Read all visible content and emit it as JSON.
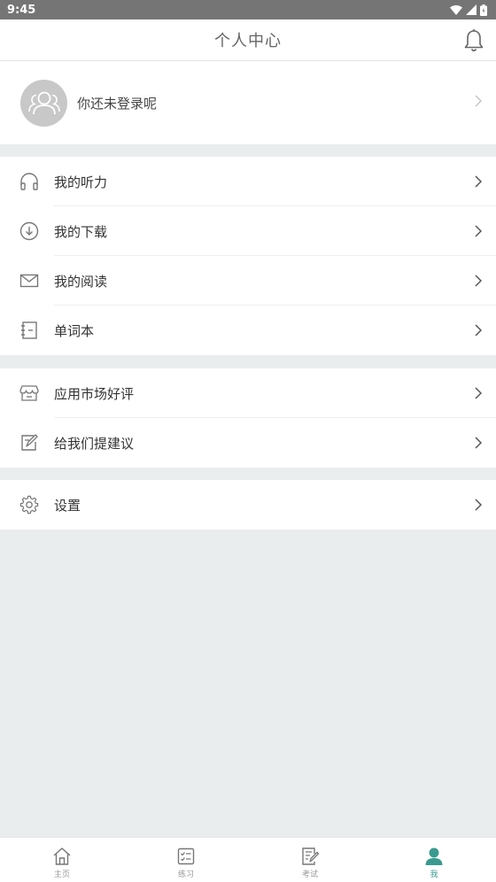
{
  "status_bar": {
    "time": "9:45"
  },
  "header": {
    "title": "个人中心"
  },
  "profile": {
    "login_prompt": "你还未登录呢"
  },
  "menu_group_1": [
    {
      "label": "我的听力",
      "icon": "headphones-icon"
    },
    {
      "label": "我的下载",
      "icon": "download-icon"
    },
    {
      "label": "我的阅读",
      "icon": "mail-icon"
    },
    {
      "label": "单词本",
      "icon": "notebook-icon"
    }
  ],
  "menu_group_2": [
    {
      "label": "应用市场好评",
      "icon": "store-icon"
    },
    {
      "label": "给我们提建议",
      "icon": "edit-icon"
    }
  ],
  "menu_group_3": [
    {
      "label": "设置",
      "icon": "gear-icon"
    }
  ],
  "tabs": [
    {
      "label": "主页",
      "icon": "home-icon",
      "active": false
    },
    {
      "label": "练习",
      "icon": "checklist-icon",
      "active": false
    },
    {
      "label": "考试",
      "icon": "exam-icon",
      "active": false
    },
    {
      "label": "我",
      "icon": "person-icon",
      "active": true
    }
  ],
  "colors": {
    "accent": "#3a9a8f",
    "background": "#e9edee",
    "status_bar": "#757575"
  }
}
